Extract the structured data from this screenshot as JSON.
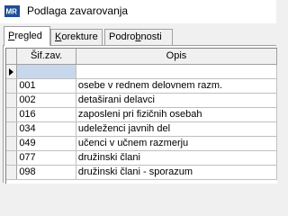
{
  "window": {
    "title": "Podlaga zavarovanja",
    "icon": "app-logo-icon"
  },
  "tabs": [
    {
      "label_pre": "",
      "label_u": "P",
      "label_post": "regled",
      "active": true
    },
    {
      "label_pre": "",
      "label_u": "K",
      "label_post": "orekture",
      "active": false
    },
    {
      "label_pre": "Podro",
      "label_u": "b",
      "label_post": "nosti",
      "active": false
    }
  ],
  "grid": {
    "columns": [
      "Šif.zav.",
      "Opis"
    ],
    "rows": [
      {
        "code": "",
        "desc": "",
        "selected": true
      },
      {
        "code": "001",
        "desc": "osebe v rednem delovnem razm.",
        "selected": false
      },
      {
        "code": "002",
        "desc": "detaširani delavci",
        "selected": false
      },
      {
        "code": "016",
        "desc": "zaposleni pri fizičnih osebah",
        "selected": false
      },
      {
        "code": "034",
        "desc": "udeleženci javnih del",
        "selected": false
      },
      {
        "code": "049",
        "desc": "učenci v učnem razmerju",
        "selected": false
      },
      {
        "code": "077",
        "desc": "družinski člani",
        "selected": false
      },
      {
        "code": "098",
        "desc": "družinski člani - sporazum",
        "selected": false
      }
    ]
  },
  "colors": {
    "selection": "#c8d8ec",
    "header_bg": "#f0f0f0"
  }
}
